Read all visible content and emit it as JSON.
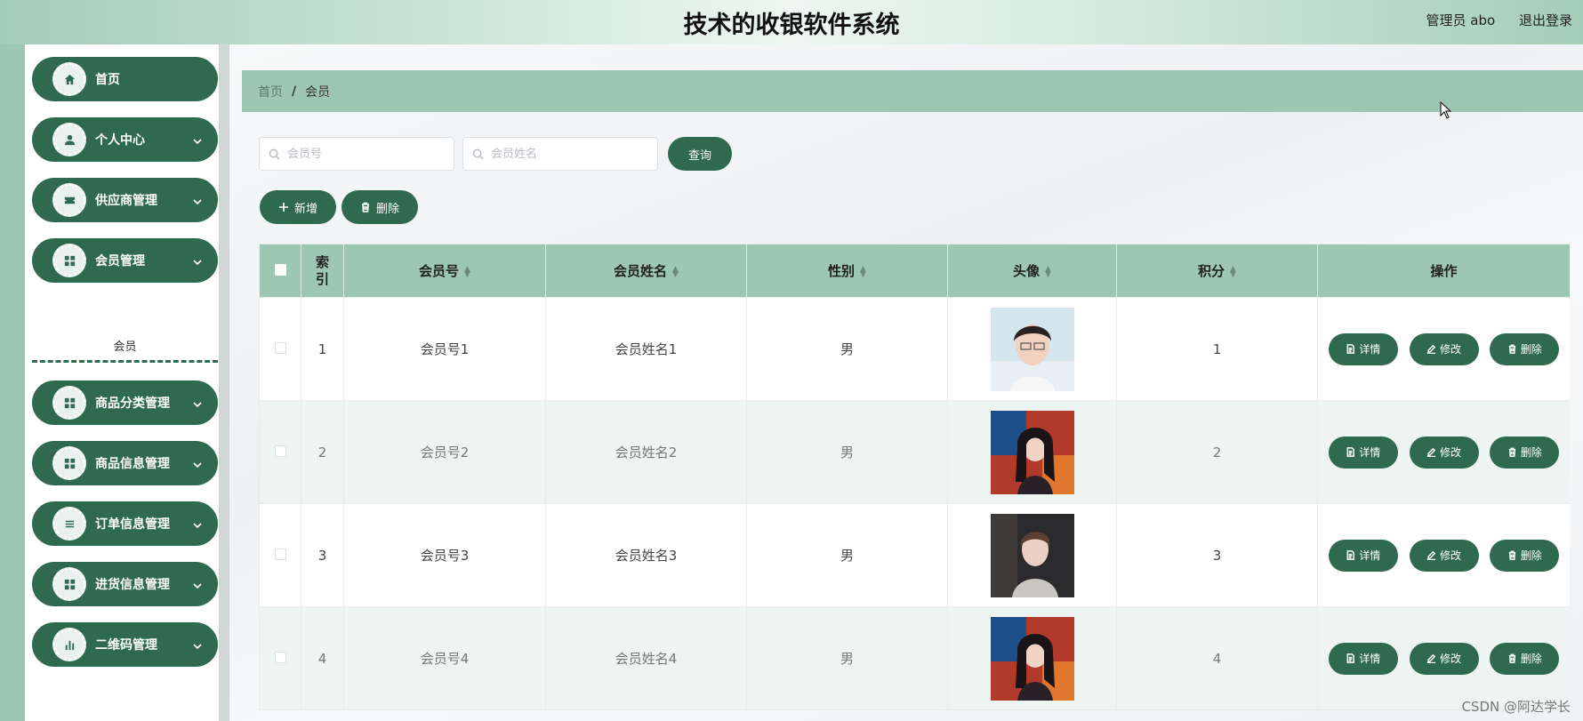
{
  "header": {
    "title": "技术的收银软件系统",
    "user": "管理员 abo",
    "logout": "退出登录"
  },
  "sidebar": {
    "items": [
      {
        "label": "首页",
        "icon": "home-icon",
        "chevron": false
      },
      {
        "label": "个人中心",
        "icon": "user-icon",
        "chevron": true
      },
      {
        "label": "供应商管理",
        "icon": "ticket-icon",
        "chevron": true
      },
      {
        "label": "会员管理",
        "icon": "grid-icon",
        "chevron": true
      },
      {
        "label": "商品分类管理",
        "icon": "grid-icon",
        "chevron": true
      },
      {
        "label": "商品信息管理",
        "icon": "grid-icon",
        "chevron": true
      },
      {
        "label": "订单信息管理",
        "icon": "list-icon",
        "chevron": true
      },
      {
        "label": "进货信息管理",
        "icon": "grid-icon",
        "chevron": true
      },
      {
        "label": "二维码管理",
        "icon": "chart-icon",
        "chevron": true
      }
    ],
    "submenu": "会员"
  },
  "breadcrumb": {
    "home": "首页",
    "separator": "/",
    "current": "会员"
  },
  "search": {
    "member_no_placeholder": "会员号",
    "member_name_placeholder": "会员姓名",
    "query_label": "查询"
  },
  "toolbar": {
    "add_label": "新增",
    "delete_label": "删除"
  },
  "table": {
    "headers": {
      "index": "索引",
      "member_no": "会员号",
      "member_name": "会员姓名",
      "gender": "性别",
      "avatar": "头像",
      "points": "积分",
      "actions": "操作"
    },
    "rows": [
      {
        "index": "1",
        "member_no": "会员号1",
        "member_name": "会员姓名1",
        "gender": "男",
        "points": "1"
      },
      {
        "index": "2",
        "member_no": "会员号2",
        "member_name": "会员姓名2",
        "gender": "男",
        "points": "2"
      },
      {
        "index": "3",
        "member_no": "会员号3",
        "member_name": "会员姓名3",
        "gender": "男",
        "points": "3"
      },
      {
        "index": "4",
        "member_no": "会员号4",
        "member_name": "会员姓名4",
        "gender": "男",
        "points": "4"
      }
    ],
    "actions": {
      "detail": "详情",
      "edit": "修改",
      "delete": "删除"
    }
  },
  "watermark": "CSDN @阿达学长",
  "colors": {
    "primary": "#2f6a50",
    "header_bg": "#9ec6b4"
  }
}
